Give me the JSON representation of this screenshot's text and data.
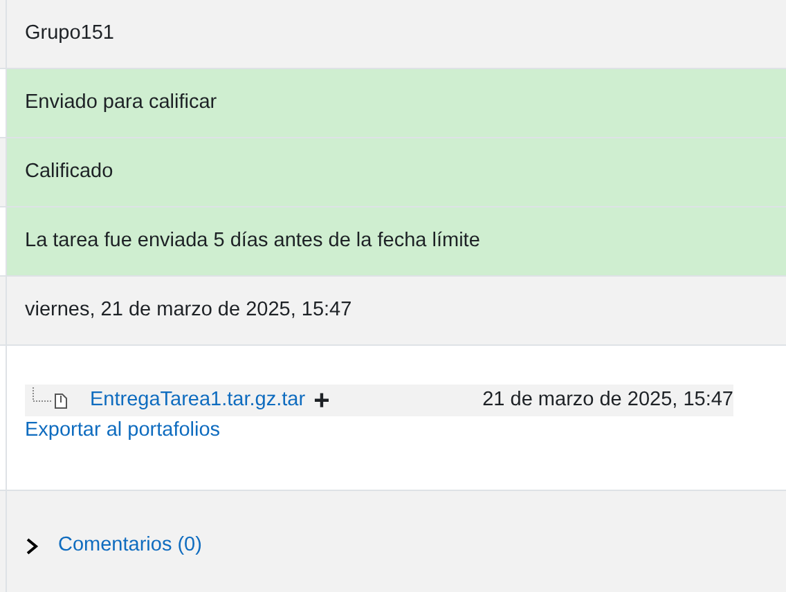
{
  "rows": [
    {
      "kind": "text",
      "text": "Grupo151",
      "color": "#f2f2f2"
    },
    {
      "kind": "text",
      "text": "Enviado para calificar",
      "color": "#cfeed0"
    },
    {
      "kind": "text",
      "text": "Calificado",
      "color": "#cfeed0"
    },
    {
      "kind": "text",
      "text": "La tarea fue enviada 5 días antes de la fecha límite",
      "color": "#cfeed0"
    },
    {
      "kind": "text",
      "text": "viernes, 21 de marzo de 2025, 15:47",
      "color": "#f2f2f2"
    },
    {
      "kind": "files",
      "files": [
        {
          "name": "EntregaTarea1.tar.gz.tar",
          "plus": "+",
          "date": "21 de marzo de 2025, 15:47"
        }
      ],
      "export_link": "Exportar al portafolios"
    },
    {
      "kind": "comments",
      "label": "Comentarios (0)",
      "expanded": false
    }
  ]
}
